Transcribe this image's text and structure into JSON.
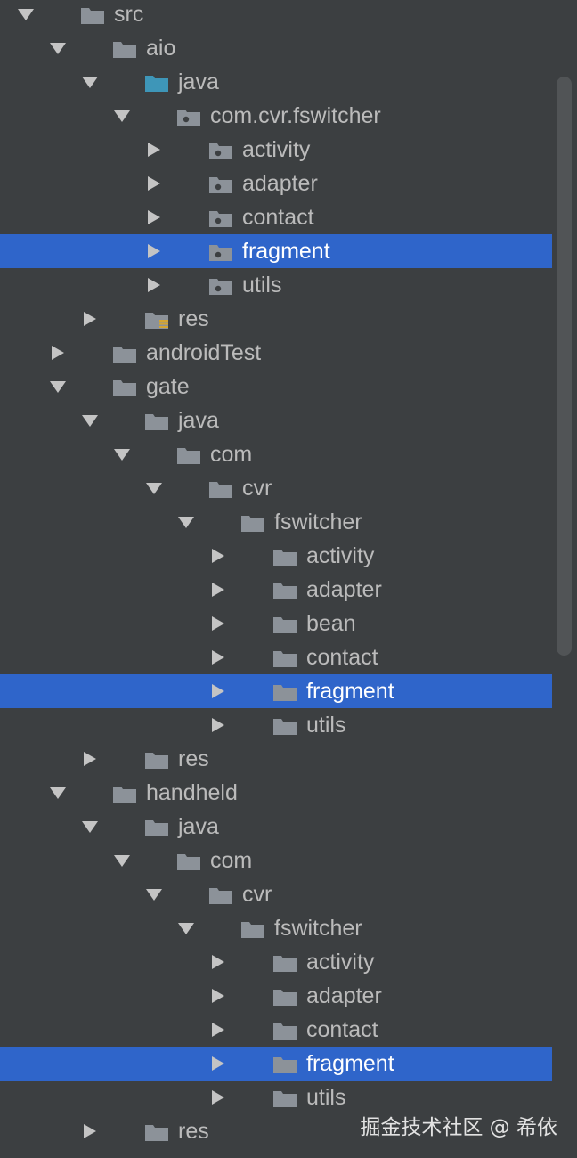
{
  "project_tree": {
    "rows": [
      {
        "depth": 0,
        "state": "expanded",
        "icon": "folder",
        "label": "src"
      },
      {
        "depth": 1,
        "state": "expanded",
        "icon": "folder",
        "label": "aio"
      },
      {
        "depth": 2,
        "state": "expanded",
        "icon": "source-folder",
        "label": "java"
      },
      {
        "depth": 3,
        "state": "expanded",
        "icon": "package",
        "label": "com.cvr.fswitcher"
      },
      {
        "depth": 4,
        "state": "collapsed",
        "icon": "package",
        "label": "activity"
      },
      {
        "depth": 4,
        "state": "collapsed",
        "icon": "package",
        "label": "adapter"
      },
      {
        "depth": 4,
        "state": "collapsed",
        "icon": "package",
        "label": "contact"
      },
      {
        "depth": 4,
        "state": "collapsed",
        "icon": "package",
        "label": "fragment",
        "selected": true
      },
      {
        "depth": 4,
        "state": "collapsed",
        "icon": "package",
        "label": "utils"
      },
      {
        "depth": 2,
        "state": "collapsed",
        "icon": "resource-folder",
        "label": "res"
      },
      {
        "depth": 1,
        "state": "collapsed",
        "icon": "folder",
        "label": "androidTest"
      },
      {
        "depth": 1,
        "state": "expanded",
        "icon": "folder",
        "label": "gate"
      },
      {
        "depth": 2,
        "state": "expanded",
        "icon": "folder",
        "label": "java"
      },
      {
        "depth": 3,
        "state": "expanded",
        "icon": "folder",
        "label": "com"
      },
      {
        "depth": 4,
        "state": "expanded",
        "icon": "folder",
        "label": "cvr"
      },
      {
        "depth": 5,
        "state": "expanded",
        "icon": "folder",
        "label": "fswitcher"
      },
      {
        "depth": 6,
        "state": "collapsed",
        "icon": "folder",
        "label": "activity"
      },
      {
        "depth": 6,
        "state": "collapsed",
        "icon": "folder",
        "label": "adapter"
      },
      {
        "depth": 6,
        "state": "collapsed",
        "icon": "folder",
        "label": "bean"
      },
      {
        "depth": 6,
        "state": "collapsed",
        "icon": "folder",
        "label": "contact"
      },
      {
        "depth": 6,
        "state": "collapsed",
        "icon": "folder",
        "label": "fragment",
        "selected": true
      },
      {
        "depth": 6,
        "state": "collapsed",
        "icon": "folder",
        "label": "utils"
      },
      {
        "depth": 2,
        "state": "collapsed",
        "icon": "folder",
        "label": "res"
      },
      {
        "depth": 1,
        "state": "expanded",
        "icon": "folder",
        "label": "handheld"
      },
      {
        "depth": 2,
        "state": "expanded",
        "icon": "folder",
        "label": "java"
      },
      {
        "depth": 3,
        "state": "expanded",
        "icon": "folder",
        "label": "com"
      },
      {
        "depth": 4,
        "state": "expanded",
        "icon": "folder",
        "label": "cvr"
      },
      {
        "depth": 5,
        "state": "expanded",
        "icon": "folder",
        "label": "fswitcher"
      },
      {
        "depth": 6,
        "state": "collapsed",
        "icon": "folder",
        "label": "activity"
      },
      {
        "depth": 6,
        "state": "collapsed",
        "icon": "folder",
        "label": "adapter"
      },
      {
        "depth": 6,
        "state": "collapsed",
        "icon": "folder",
        "label": "contact"
      },
      {
        "depth": 6,
        "state": "collapsed",
        "icon": "folder",
        "label": "fragment",
        "selected": true
      },
      {
        "depth": 6,
        "state": "collapsed",
        "icon": "folder",
        "label": "utils"
      },
      {
        "depth": 2,
        "state": "collapsed",
        "icon": "folder",
        "label": "res"
      }
    ]
  },
  "watermark": {
    "text": "掘金技术社区 @ 希依"
  },
  "colors": {
    "background": "#3c3f41",
    "text": "#bbbbbb",
    "selection": "#2f65ca",
    "selected_text": "#ffffff",
    "folder_icon": "#8c9299",
    "source_folder_icon": "#3e96b8",
    "resource_badge": "#d3a533"
  }
}
